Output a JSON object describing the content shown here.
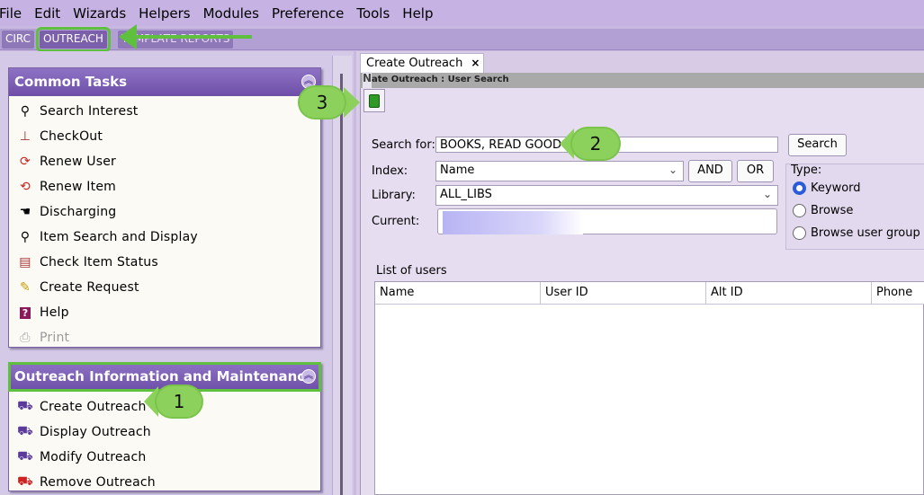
{
  "menu": [
    "File",
    "Edit",
    "Wizards",
    "Helpers",
    "Modules",
    "Preference",
    "Tools",
    "Help"
  ],
  "module_tabs": [
    "CIRC",
    "OUTREACH",
    "TEMPLATE REPORTS"
  ],
  "panels": {
    "common": {
      "title": "Common Tasks",
      "items": [
        {
          "label": "Search Interest",
          "icon": "binoculars-icon"
        },
        {
          "label": "CheckOut",
          "icon": "stamp-icon"
        },
        {
          "label": "Renew User",
          "icon": "renew-user-icon"
        },
        {
          "label": "Renew Item",
          "icon": "renew-item-icon"
        },
        {
          "label": "Discharging",
          "icon": "discharge-icon"
        },
        {
          "label": "Item Search and Display",
          "icon": "item-search-icon"
        },
        {
          "label": "Check Item Status",
          "icon": "item-status-icon"
        },
        {
          "label": "Create Request",
          "icon": "create-request-icon"
        },
        {
          "label": "Help",
          "icon": "help-icon"
        },
        {
          "label": "Print",
          "icon": "printer-icon",
          "disabled": true
        }
      ]
    },
    "outreach": {
      "title": "Outreach Information and Maintenance",
      "items": [
        {
          "label": "Create Outreach",
          "icon": "create-outreach-icon"
        },
        {
          "label": "Display Outreach",
          "icon": "display-outreach-icon"
        },
        {
          "label": "Modify Outreach",
          "icon": "modify-outreach-icon"
        },
        {
          "label": "Remove Outreach",
          "icon": "remove-outreach-icon"
        }
      ]
    }
  },
  "doc_tab": {
    "label": "Create Outreach",
    "close": "×"
  },
  "subtitle": "ate Outreach : User Search",
  "subtitle_prefix": "N",
  "form": {
    "search_label": "Search for:",
    "search_value": "BOOKS, READ GOOD",
    "search_button": "Search",
    "index_label": "Index:",
    "index_value": "Name",
    "and_button": "AND",
    "or_button": "OR",
    "library_label": "Library:",
    "library_value": "ALL_LIBS",
    "current_label": "Current:"
  },
  "type_group": {
    "label": "Type:",
    "options": [
      {
        "label": "Keyword",
        "selected": true
      },
      {
        "label": "Browse",
        "selected": false
      },
      {
        "label": "Browse user group",
        "selected": false
      }
    ]
  },
  "users_list": {
    "label": "List of users",
    "columns": [
      "Name",
      "User ID",
      "Alt ID",
      "Phone"
    ]
  },
  "callouts": [
    "1",
    "2",
    "3"
  ],
  "colors": {
    "accent": "#7b5fab",
    "highlight": "#5fbf3f",
    "callout": "#8cd15c"
  }
}
